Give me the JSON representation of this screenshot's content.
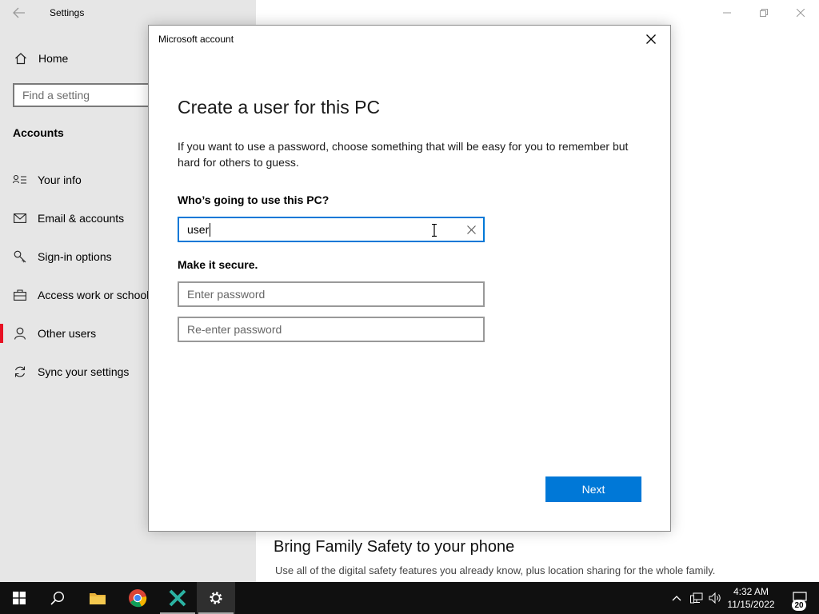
{
  "settings": {
    "title": "Settings",
    "home_label": "Home",
    "search_placeholder": "Find a setting",
    "section_title": "Accounts",
    "nav_items": [
      {
        "label": "Your info",
        "icon": "contact-card-icon"
      },
      {
        "label": "Email & accounts",
        "icon": "mail-icon"
      },
      {
        "label": "Sign-in options",
        "icon": "key-icon"
      },
      {
        "label": "Access work or school",
        "icon": "briefcase-icon"
      },
      {
        "label": "Other users",
        "icon": "person-icon",
        "active": true
      },
      {
        "label": "Sync your settings",
        "icon": "sync-icon"
      }
    ],
    "main": {
      "family_heading": "Bring Family Safety to your phone",
      "family_sub": "Use all of the digital safety features you already know, plus location sharing for the whole family."
    }
  },
  "dialog": {
    "title": "Microsoft account",
    "heading": "Create a user for this PC",
    "description": "If you want to use a password, choose something that will be easy for you to remember but hard for others to guess.",
    "who_label": "Who’s going to use this PC?",
    "username_value": "user",
    "secure_label": "Make it secure.",
    "password_placeholder": "Enter password",
    "reenter_placeholder": "Re-enter password",
    "next_label": "Next"
  },
  "taskbar": {
    "time": "4:32 AM",
    "date": "11/15/2022",
    "notification_count": "20"
  },
  "colors": {
    "accent": "#0078d7",
    "active_indicator": "#e81123",
    "sidebar_bg": "#e6e6e6",
    "taskbar_bg": "#101010"
  }
}
